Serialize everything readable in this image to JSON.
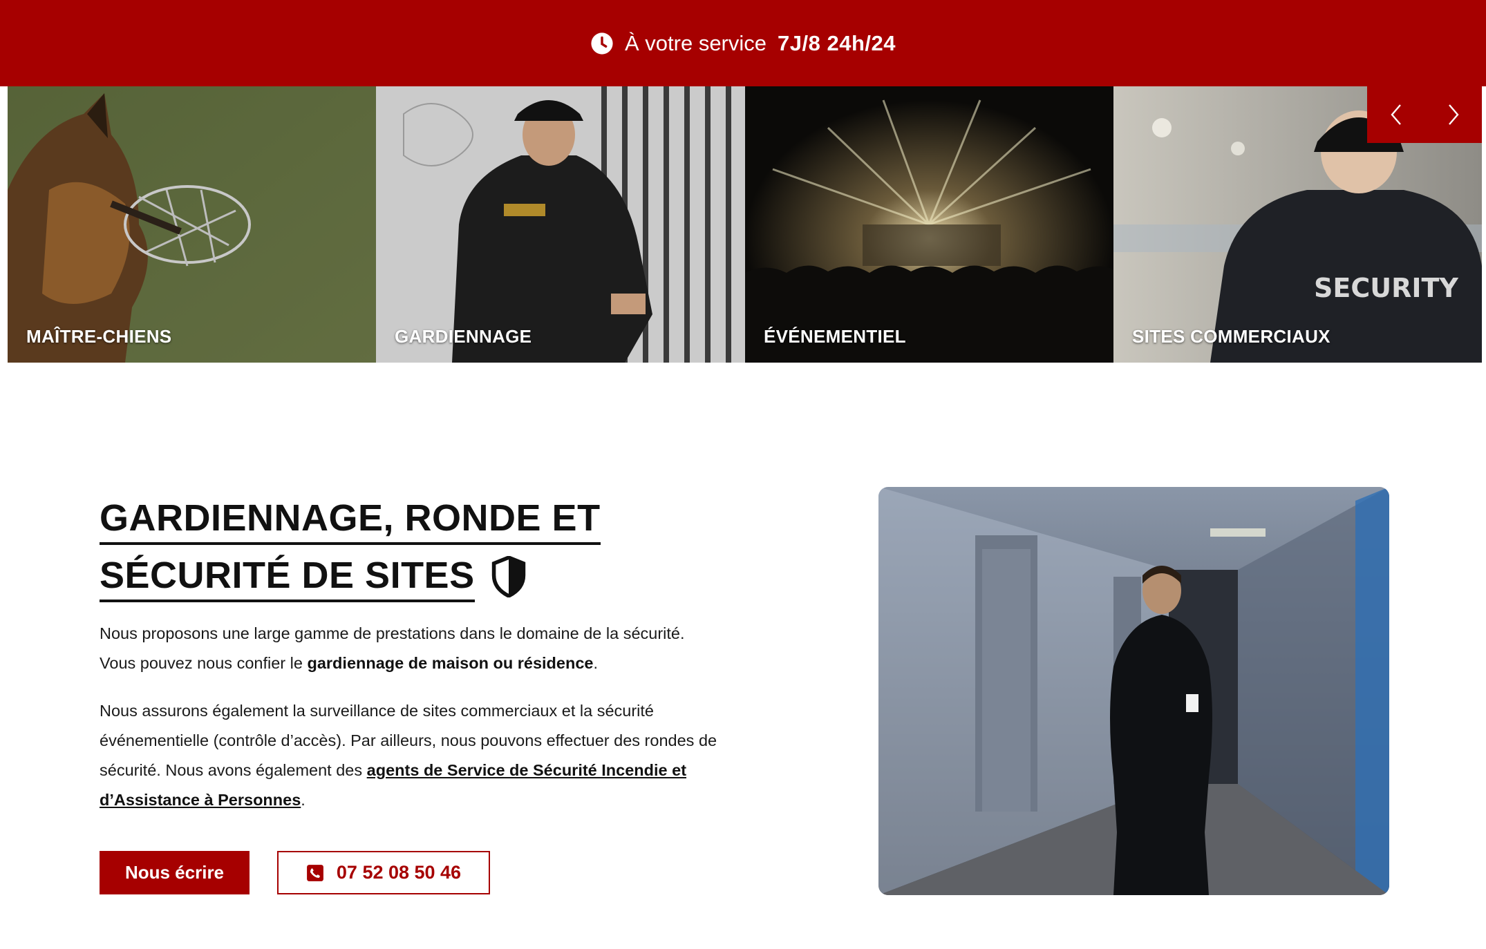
{
  "topbar": {
    "icon": "clock-icon",
    "text": "À votre service",
    "highlight": "7J/8 24h/24"
  },
  "carousel": {
    "items": [
      {
        "label": "MAÎTRE-CHIENS",
        "image": "muzzled-shepherd-dog-photo"
      },
      {
        "label": "GARDIENNAGE",
        "image": "security-guard-at-gate-photo"
      },
      {
        "label": "ÉVÉNEMENTIEL",
        "image": "concert-crowd-photo"
      },
      {
        "label": "SITES COMMERCIAUX",
        "image": "security-agent-back-photo"
      }
    ],
    "prev_icon": "chevron-left-icon",
    "next_icon": "chevron-right-icon"
  },
  "main": {
    "title_line1": "GARDIENNAGE, RONDE ET",
    "title_line2": "SÉCURITÉ DE SITES",
    "title_icon": "shield-icon",
    "p1_text": "Nous proposons une large gamme de prestations dans le domaine de la sécurité. Vous pouvez nous confier le ",
    "p1_bold": "gardiennage de maison ou résidence",
    "p1_end": ".",
    "p2_text": "Nous assurons également la surveillance de sites commerciaux et la sécurité événementielle (contrôle d’accès). Par ailleurs, nous pouvons effectuer des rondes de sécurité. Nous avons également des ",
    "p2_link": "agents de Service de Sécurité Incendie et d’Assistance à Personnes",
    "p2_end": ".",
    "btn_write": "Nous écrire",
    "btn_phone": "07 52 08 50 46",
    "phone_icon": "phone-icon",
    "hero_image": "guard-in-corridor-photo"
  },
  "colors": {
    "brand_red": "#a60000",
    "text_dark": "#111111",
    "background": "#ffffff"
  }
}
